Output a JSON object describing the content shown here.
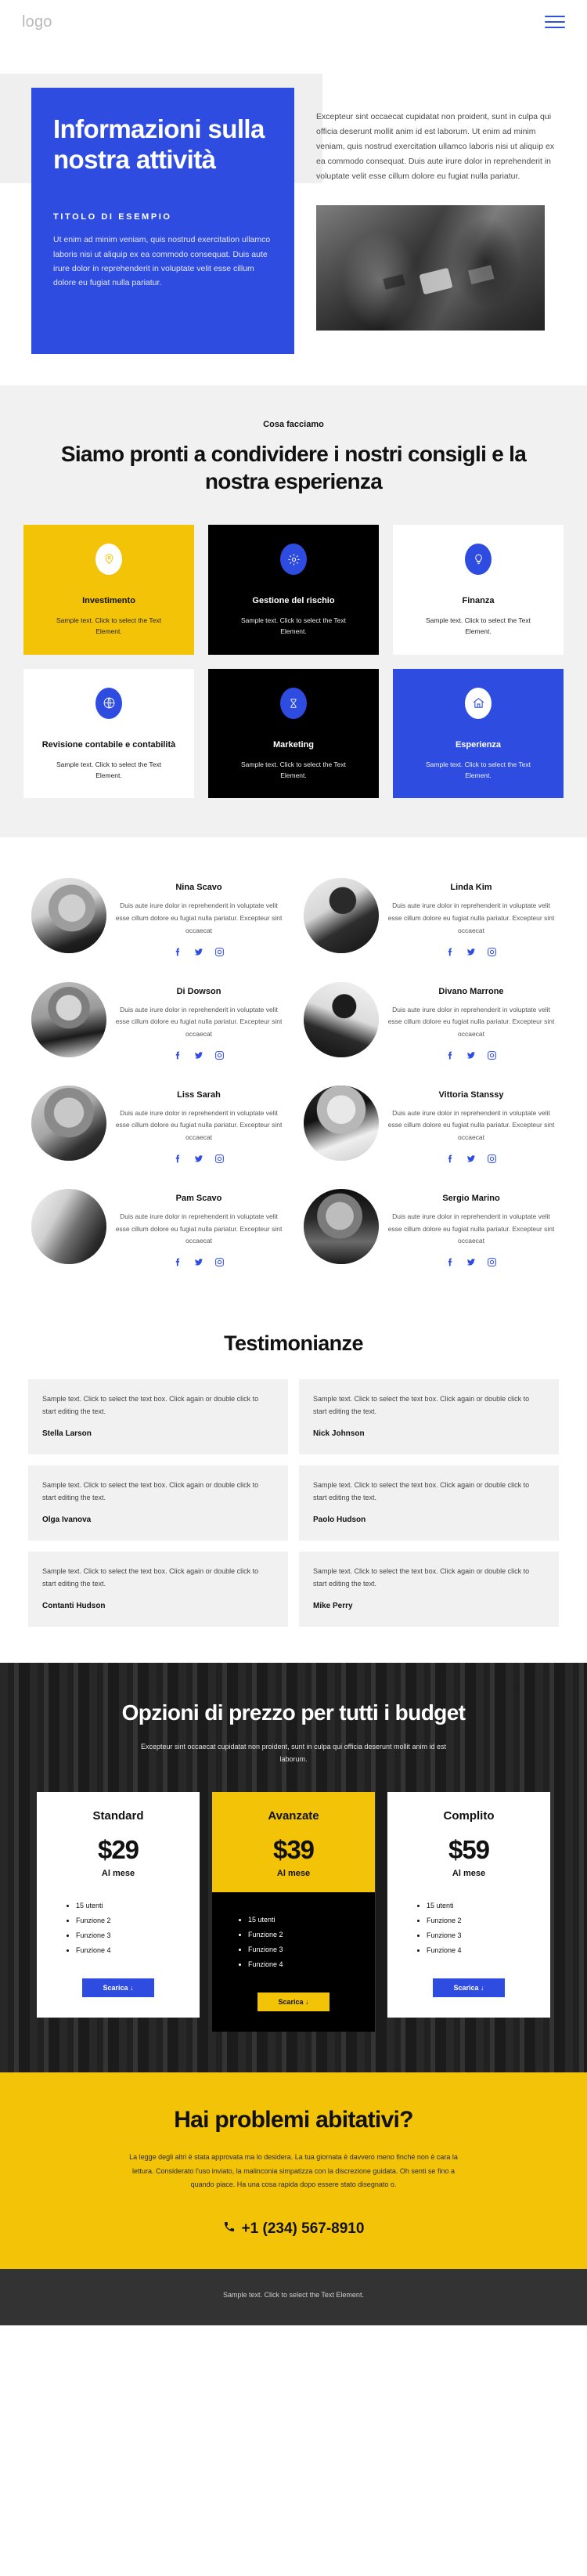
{
  "header": {
    "logo": "logo",
    "menu_icon": "hamburger-menu-icon"
  },
  "hero": {
    "title": "Informazioni sulla nostra attività",
    "kicker": "TITOLO DI ESEMPIO",
    "blue_body": "Ut enim ad minim veniam, quis nostrud exercitation ullamco laboris nisi ut aliquip ex ea commodo consequat. Duis aute irure dolor in reprehenderit in voluptate velit esse cillum dolore eu fugiat nulla pariatur.",
    "right_body": "Excepteur sint occaecat cupidatat non proident, sunt in culpa qui officia deserunt mollit anim id est laborum. Ut enim ad minim veniam, quis nostrud exercitation ullamco laboris nisi ut aliquip ex ea commodo consequat. Duis aute irure dolor in reprehenderit in voluptate velit esse cillum dolore eu fugiat nulla pariatur."
  },
  "services": {
    "eyebrow": "Cosa facciamo",
    "heading": "Siamo pronti a condividere i nostri consigli e la nostra esperienza",
    "cards": [
      {
        "title": "Investimento",
        "text": "Sample text. Click to select the Text Element.",
        "icon": "location-pin-icon",
        "theme": "yellow"
      },
      {
        "title": "Gestione del rischio",
        "text": "Sample text. Click to select the Text Element.",
        "icon": "gear-icon",
        "theme": "black"
      },
      {
        "title": "Finanza",
        "text": "Sample text. Click to select the Text Element.",
        "icon": "lightbulb-icon",
        "theme": "white"
      },
      {
        "title": "Revisione contabile e contabilità",
        "text": "Sample text. Click to select the Text Element.",
        "icon": "globe-icon",
        "theme": "white"
      },
      {
        "title": "Marketing",
        "text": "Sample text. Click to select the Text Element.",
        "icon": "hourglass-icon",
        "theme": "black"
      },
      {
        "title": "Esperienza",
        "text": "Sample text. Click to select the Text Element.",
        "icon": "home-icon",
        "theme": "blue"
      }
    ]
  },
  "team": {
    "bio": "Duis aute irure dolor in reprehenderit in voluptate velit esse cillum dolore eu fugiat nulla pariatur. Excepteur sint occaecat",
    "socials": [
      "facebook-icon",
      "twitter-icon",
      "instagram-icon"
    ],
    "members": [
      {
        "name": "Nina Scavo"
      },
      {
        "name": "Linda Kim"
      },
      {
        "name": "Di Dowson"
      },
      {
        "name": "Divano Marrone"
      },
      {
        "name": "Liss Sarah"
      },
      {
        "name": "Vittoria Stanssy"
      },
      {
        "name": "Pam Scavo"
      },
      {
        "name": "Sergio Marino"
      }
    ]
  },
  "testimonials": {
    "heading": "Testimonianze",
    "text": "Sample text. Click to select the text box. Click again or double click to start editing the text.",
    "items": [
      {
        "name": "Stella Larson"
      },
      {
        "name": "Nick Johnson"
      },
      {
        "name": "Olga Ivanova"
      },
      {
        "name": "Paolo Hudson"
      },
      {
        "name": "Contanti Hudson"
      },
      {
        "name": "Mike Perry"
      }
    ]
  },
  "pricing": {
    "heading": "Opzioni di prezzo per tutti i budget",
    "subtitle": "Excepteur sint occaecat cupidatat non proident, sunt in culpa qui officia deserunt mollit anim id est laborum.",
    "period": "Al mese",
    "button_label": "Scarica ↓",
    "features": [
      "15 utenti",
      "Funzione 2",
      "Funzione 3",
      "Funzione 4"
    ],
    "plans": [
      {
        "name": "Standard",
        "price": "$29",
        "featured": false
      },
      {
        "name": "Avanzate",
        "price": "$39",
        "featured": true
      },
      {
        "name": "Complito",
        "price": "$59",
        "featured": false
      }
    ]
  },
  "cta": {
    "heading": "Hai problemi abitativi?",
    "text": "La legge degli altri è stata approvata ma lo desidera. La tua giornata è davvero meno finché non è cara la lettura. Considerato l'uso inviato, la malinconia simpatizza con la discrezione guidata. Oh senti se fino a quando piace. Ha una cosa rapida dopo essere stato disegnato o.",
    "phone": "+1 (234) 567-8910",
    "phone_icon": "phone-icon"
  },
  "footer": {
    "text": "Sample text. Click to select the Text Element."
  },
  "colors": {
    "blue": "#2f4ce0",
    "yellow": "#f2c307",
    "black": "#000000",
    "grey_bg": "#f1f1f1",
    "footer_bg": "#333333"
  }
}
